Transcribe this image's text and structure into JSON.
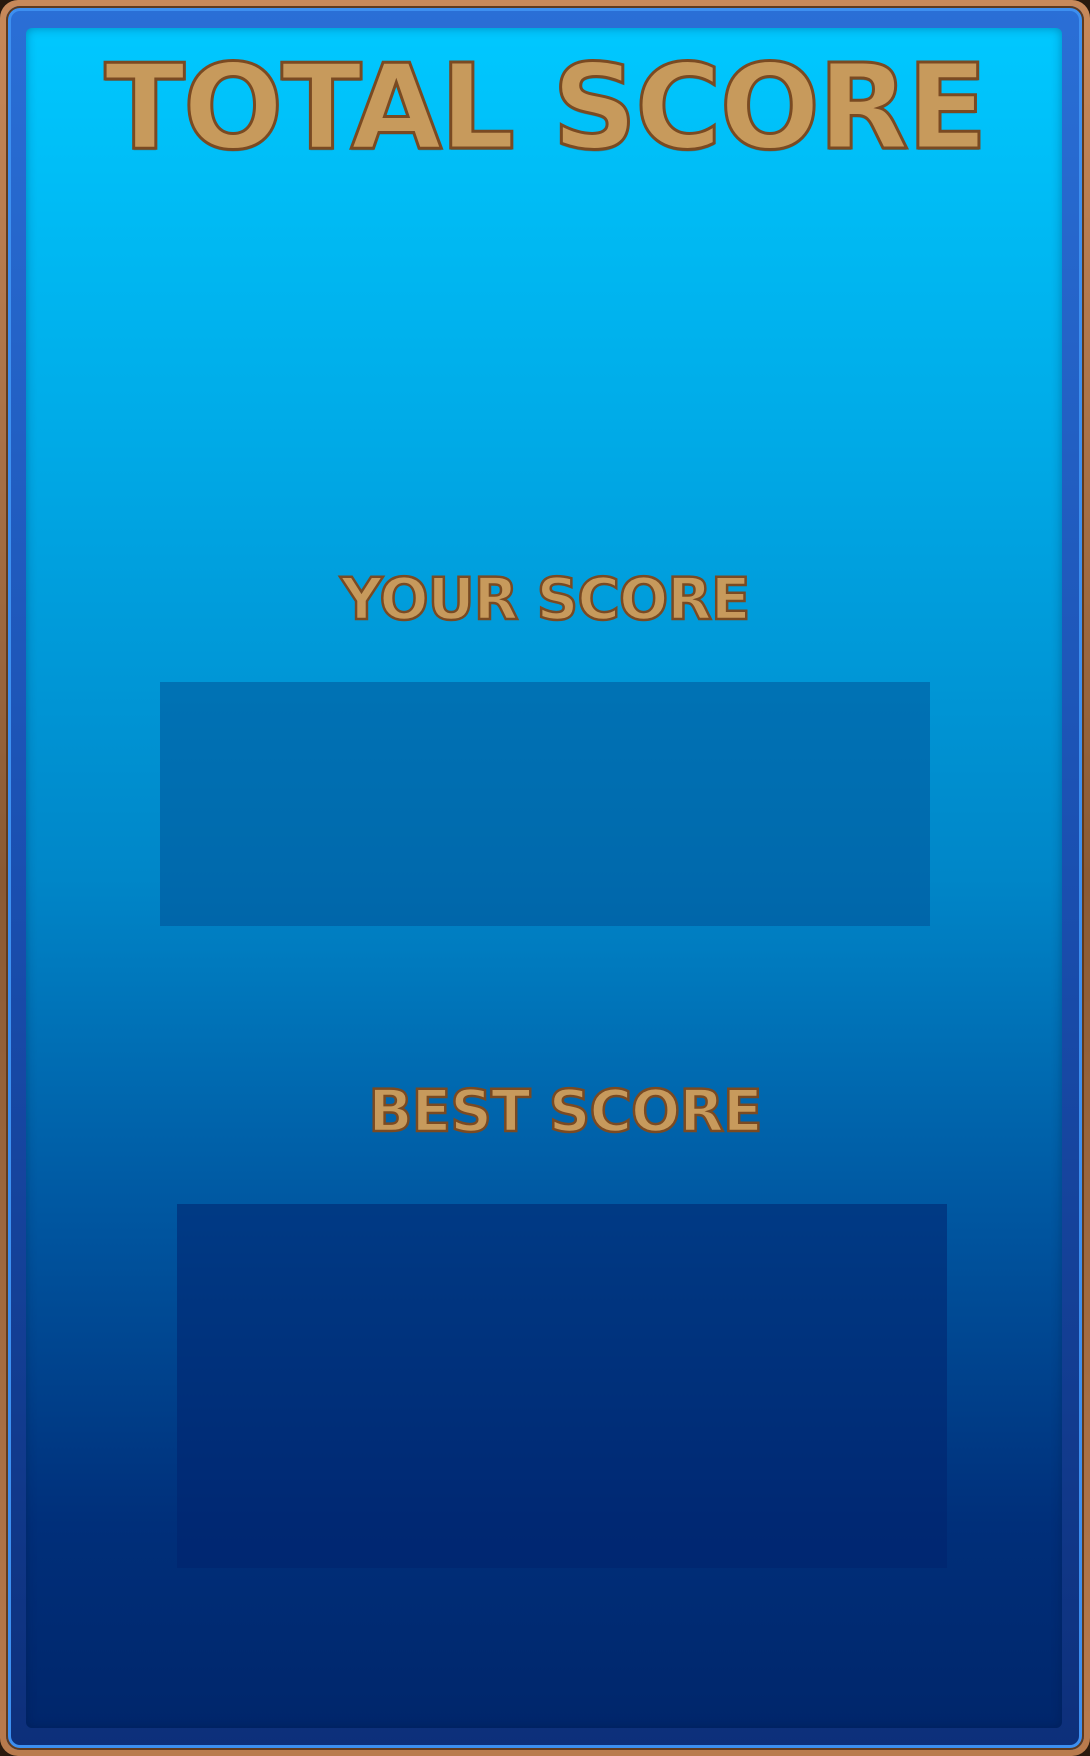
{
  "screen": {
    "title": "TOTAL SCORE"
  },
  "your_score": {
    "label": "YOUR SCORE",
    "value": ""
  },
  "best_score": {
    "label": "BEST SCORE",
    "value": ""
  },
  "colors": {
    "text_fill": "#c79a5c",
    "text_outline": "#7a4a22",
    "panel_top": "#00c8ff",
    "panel_bottom": "#00266b",
    "frame_wood": "#8a5a34",
    "frame_rim": "#1a4fb0"
  }
}
